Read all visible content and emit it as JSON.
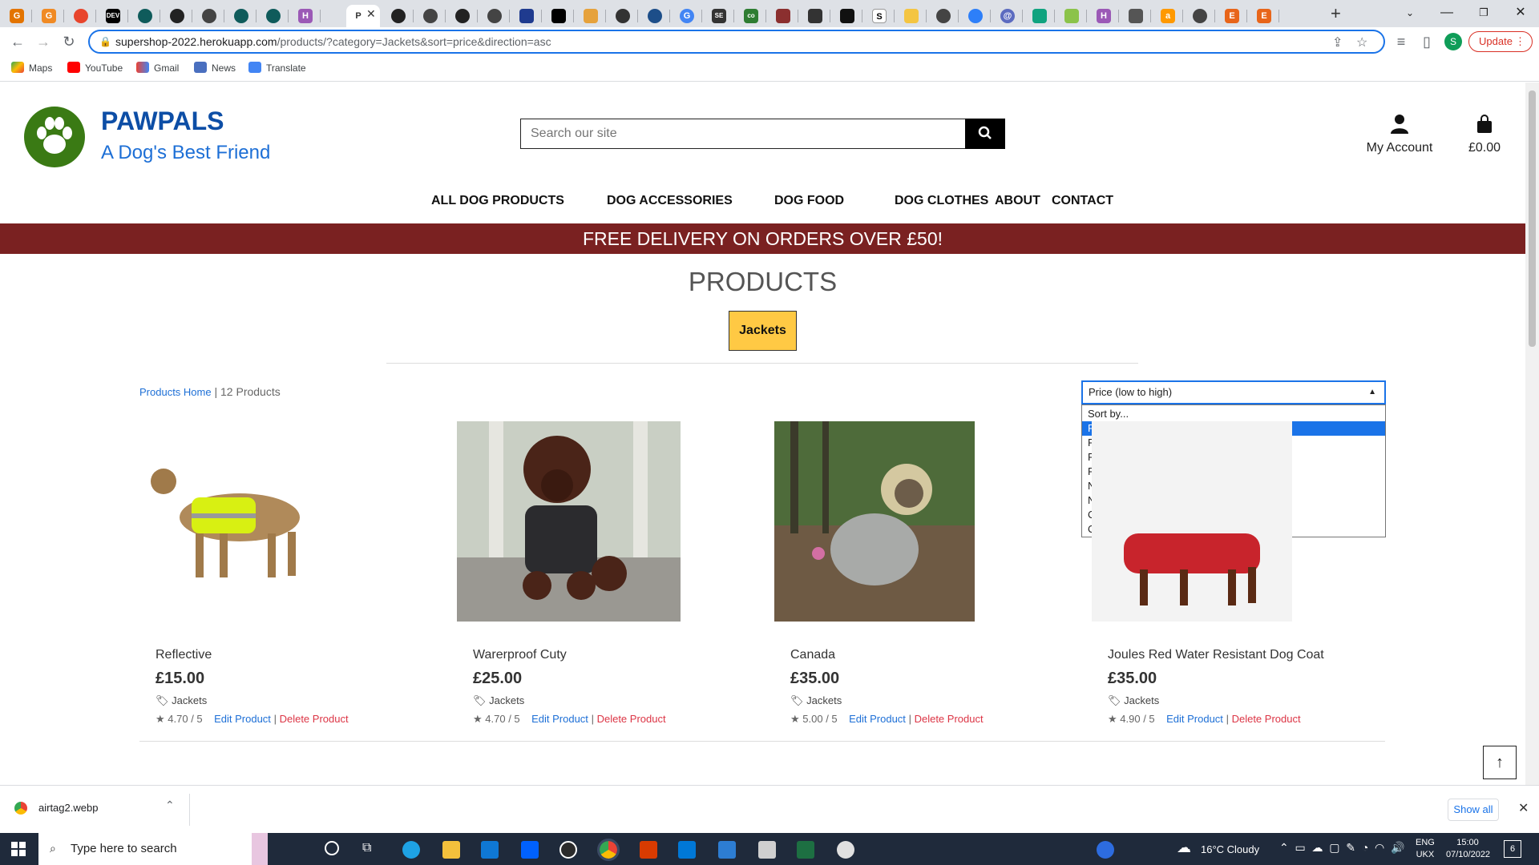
{
  "browser": {
    "address": "supershop-2022.herokuapp.com",
    "address_rest": "/products/?category=Jackets&sort=price&direction=asc",
    "update_label": "Update",
    "profile_initial": "S",
    "bookmarks": [
      "Maps",
      "YouTube",
      "Gmail",
      "News",
      "Translate"
    ]
  },
  "site": {
    "brand_name": "PAWPALS",
    "brand_tagline": "A Dog's Best Friend",
    "search_placeholder": "Search our site",
    "account_label": "My Account",
    "bag_total": "£0.00",
    "nav": [
      "ALL DOG PRODUCTS",
      "DOG ACCESSORIES",
      "DOG FOOD",
      "DOG CLOTHES",
      "ABOUT",
      "CONTACT"
    ],
    "banner": "FREE DELIVERY ON ORDERS OVER £50!"
  },
  "products_page": {
    "title": "PRODUCTS",
    "category_badge": "Jackets",
    "breadcrumb_link": "Products Home",
    "breadcrumb_sep": "|",
    "count_label": "12 Products",
    "sort": {
      "selected": "Price (low to high)",
      "options": [
        "Sort by...",
        "Price (low to high)",
        "Price (high to low)",
        "Rating (low to high)",
        "Rating (high to low)",
        "Name (A-Z)",
        "Name (Z-A)",
        "Category (A-Z)",
        "Category (Z-A)"
      ]
    },
    "products": [
      {
        "name": "Reflective",
        "price": "£15.00",
        "category": "Jackets",
        "rating": "4.70 / 5",
        "edit": "Edit Product",
        "sep": "|",
        "delete": "Delete Product"
      },
      {
        "name": "Warerproof Cuty",
        "price": "£25.00",
        "category": "Jackets",
        "rating": "4.70 / 5",
        "edit": "Edit Product",
        "sep": "|",
        "delete": "Delete Product"
      },
      {
        "name": "Canada",
        "price": "£35.00",
        "category": "Jackets",
        "rating": "5.00 / 5",
        "edit": "Edit Product",
        "sep": "|",
        "delete": "Delete Product"
      },
      {
        "name": "Joules Red Water Resistant Dog Coat",
        "price": "£35.00",
        "category": "Jackets",
        "rating": "4.90 / 5",
        "edit": "Edit Product",
        "sep": "|",
        "delete": "Delete Product"
      }
    ]
  },
  "download": {
    "file": "airtag2.webp",
    "show_all": "Show all"
  },
  "taskbar": {
    "search_placeholder": "Type here to search",
    "weather": "16°C  Cloudy",
    "lang1": "ENG",
    "lang2": "UKX",
    "time": "15:00",
    "date": "07/10/2022",
    "notif_count": "6"
  },
  "colors": {
    "brand_blue": "#0d4ea6",
    "banner": "#7a2121",
    "badge": "#ffc944",
    "link": "#1d6fd6",
    "delete": "#dc3545"
  }
}
